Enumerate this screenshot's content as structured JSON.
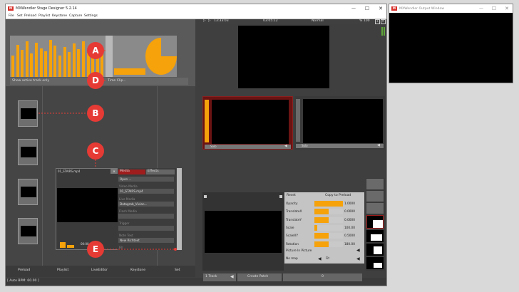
{
  "main_window": {
    "title": "MXWendler Stage Designer 5.2.14",
    "menu": [
      "File",
      "Set",
      "Preload",
      "Playlist",
      "Keystone",
      "Capture",
      "Settings"
    ]
  },
  "output_window": {
    "title": "MXWendler Output Window"
  },
  "top_left": {
    "active_track_label": "Show active track only",
    "time_clip_label": "Time Clip..."
  },
  "transport": {
    "time_elapsed": "13:33:03",
    "time_remaining": "03:05:12",
    "mode": "Normal",
    "speed": "% 100"
  },
  "slots": [
    {
      "label": "Solo"
    },
    {
      "label": "Solo"
    }
  ],
  "media_panel": {
    "clip_title": "01_STAIRS.mp4",
    "tabs": [
      "Media",
      "Effects"
    ],
    "open_label": "Open ...",
    "video_media_label": "Video Media",
    "video_media_value": "01_STAIRS.mp4",
    "live_media_label": "Live Media",
    "live_media_value": "Datagrab_Vivian...",
    "flash_media_label": "Flash Media",
    "trigger_label": "Trigger",
    "note_label": "Note Text",
    "note_value": "New Richtext",
    "fill_label": "Fill",
    "time_value": "00:00"
  },
  "bottom_tabs": [
    "Preload",
    "Playlist",
    "LiveEditor",
    "Keystone",
    "Set"
  ],
  "status_bar": "[ Auto BPM: 60.00 ]",
  "properties": {
    "reset_label": "Reset",
    "copy_label": "Copy to Preload",
    "rows": [
      {
        "label": "Opacity",
        "value": "1.0000",
        "level": 1.0
      },
      {
        "label": "TranslateX",
        "value": "0.0000",
        "level": 0.5
      },
      {
        "label": "TranslateY",
        "value": "0.0000",
        "level": 0.5
      },
      {
        "label": "Scale",
        "value": "100.00",
        "level": 0.1
      },
      {
        "label": "ScaleXY",
        "value": "0.5000",
        "level": 0.5
      },
      {
        "label": "Rotation",
        "value": "180.00",
        "level": 0.5
      }
    ],
    "pip_label": "Picture In Picture",
    "no_map_label": "No map",
    "fit_label": "Fit"
  },
  "bottom_buttons": {
    "track_label": "1 Track",
    "create_patch_label": "Create Patch",
    "number_label": "0"
  },
  "callouts": [
    "A",
    "B",
    "C",
    "D",
    "E"
  ],
  "colors": {
    "accent": "#f5a20b",
    "callout": "#e63a35"
  }
}
